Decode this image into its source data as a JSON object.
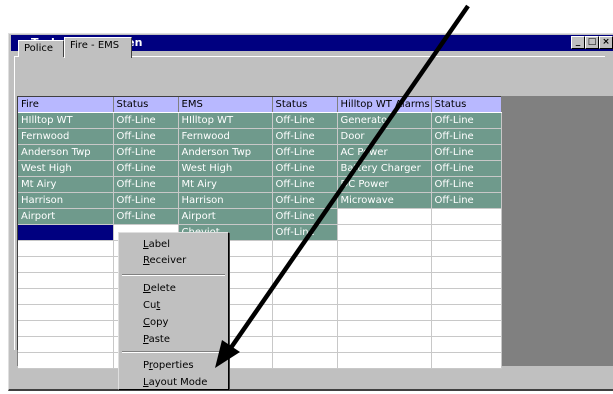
{
  "window": {
    "title": "Technician Screen",
    "controls": [
      "minimize-icon",
      "maximize-icon",
      "close-icon"
    ]
  },
  "tabs": [
    {
      "label": "Police",
      "active": false
    },
    {
      "label": "Fire - EMS",
      "active": true
    }
  ],
  "grid": {
    "columns": [
      "Fire",
      "Status",
      "EMS",
      "Status",
      "Hilltop WT Alarms",
      "Status"
    ],
    "rows": [
      [
        "HIlltop WT",
        "Off-Line",
        "HIlltop WT",
        "Off-Line",
        "Generator",
        "Off-Line"
      ],
      [
        "Fernwood",
        "Off-Line",
        "Fernwood",
        "Off-Line",
        "Door",
        "Off-Line"
      ],
      [
        "Anderson Twp",
        "Off-Line",
        "Anderson Twp",
        "Off-Line",
        "AC Power",
        "Off-Line"
      ],
      [
        "West High",
        "Off-Line",
        "West High",
        "Off-Line",
        "Battery Charger",
        "Off-Line"
      ],
      [
        "Mt Airy",
        "Off-Line",
        "Mt Airy",
        "Off-Line",
        "DC Power",
        "Off-Line"
      ],
      [
        "Harrison",
        "Off-Line",
        "Harrison",
        "Off-Line",
        "Microwave",
        "Off-Line"
      ],
      [
        "Airport",
        "Off-Line",
        "Airport",
        "Off-Line",
        "",
        ""
      ],
      [
        "",
        "",
        "Cheviot",
        "Off-Line",
        "",
        ""
      ]
    ],
    "empty_rows": 8
  },
  "context_menu": {
    "items": [
      {
        "label": "Label",
        "accel": "L"
      },
      {
        "label": "Receiver",
        "accel": "R"
      },
      {
        "sep": true
      },
      {
        "label": "Delete",
        "accel": "D"
      },
      {
        "label": "Cut",
        "accel": "t"
      },
      {
        "label": "Copy",
        "accel": "C"
      },
      {
        "label": "Paste",
        "accel": "P"
      },
      {
        "sep": true
      },
      {
        "label": "Properties",
        "accel": "r"
      },
      {
        "label": "Layout Mode",
        "accel": "L"
      }
    ]
  },
  "colors": {
    "title_bar": "#000080",
    "header_row": "#b8b8ff",
    "filled_cell": "#6f9a8c",
    "selected_cell": "#000080",
    "arrow": "#000000"
  }
}
